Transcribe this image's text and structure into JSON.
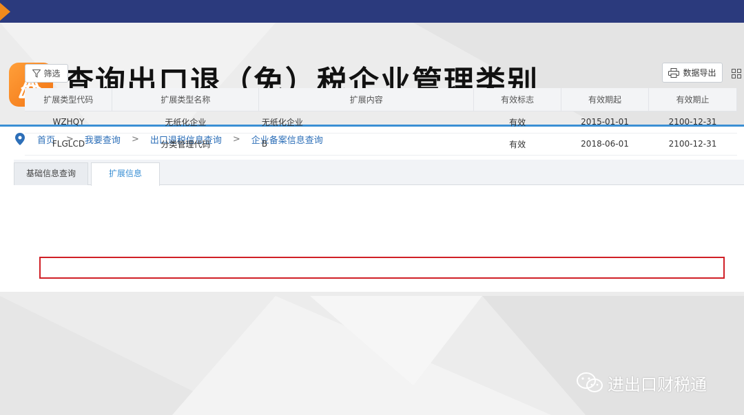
{
  "slide": {
    "title": "查询出口退（免）税企业管理类别",
    "watermark": "进出口财税通"
  },
  "breadcrumb": [
    {
      "label": "首页"
    },
    {
      "label": "我要查询"
    },
    {
      "label": "出口退税信息查询"
    },
    {
      "label": "企业备案信息查询"
    }
  ],
  "breadcrumb_sep": ">",
  "tabs": [
    {
      "label": "基础信息查询",
      "active": false
    },
    {
      "label": "扩展信息",
      "active": true
    }
  ],
  "toolbar": {
    "filter_label": "筛选",
    "export_label": "数据导出"
  },
  "table": {
    "headers": [
      "扩展类型代码",
      "扩展类型名称",
      "扩展内容",
      "有效标志",
      "有效期起",
      "有效期止"
    ],
    "rows": [
      [
        "WZHQY",
        "无纸化企业",
        "无纸化企业",
        "有效",
        "2015-01-01",
        "2100-12-31"
      ],
      [
        "FLGLCD",
        "分类管理代码",
        "B",
        "有效",
        "2018-06-01",
        "2100-12-31"
      ]
    ],
    "highlighted_row": 1
  },
  "colors": {
    "top_bar": "#2b3a7d",
    "accent_orange": "#f08a1c",
    "link_blue": "#2d6fb8",
    "highlight_red": "#d01f26"
  },
  "icons": [
    "location-pin-icon",
    "app-compass-icon",
    "filter-icon",
    "printer-icon",
    "column-settings-icon",
    "wechat-icon"
  ]
}
